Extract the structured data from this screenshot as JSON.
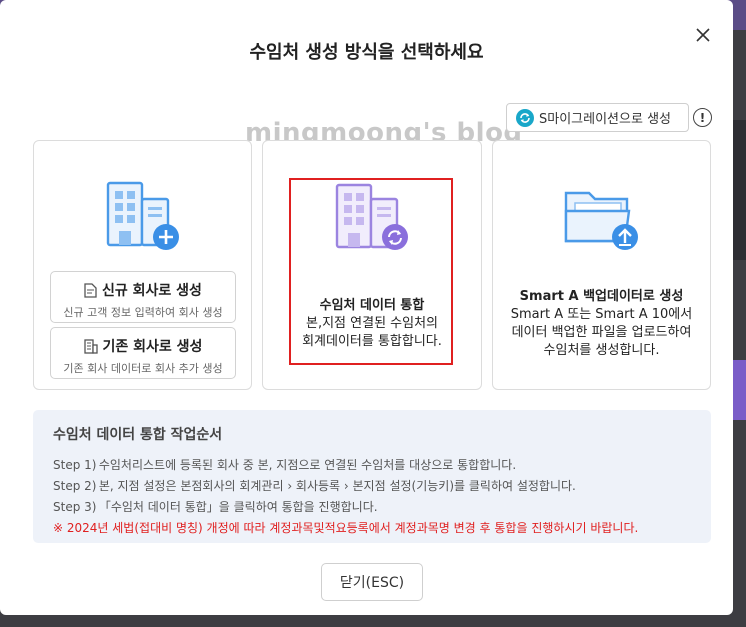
{
  "modal": {
    "title": "수임처 생성 방식을 선택하세요",
    "watermark": "mingmoong's blog"
  },
  "migrate_button": {
    "label": "S마이그레이션으로 생성"
  },
  "info_button": {
    "label": "!"
  },
  "card_new": {
    "new_company": {
      "title": "신규 회사로 생성",
      "subtitle": "신규 고객 정보 입력하여 회사 생성"
    },
    "existing_company": {
      "title": "기존 회사로 생성",
      "subtitle": "기존 회사 데이터로 회사 추가 생성"
    }
  },
  "card_merge": {
    "title": "수임처 데이터 통합",
    "line1": "본,지점 연결된 수임처의",
    "line2": "회계데이터를 통합합니다."
  },
  "card_backup": {
    "title": "Smart A 백업데이터로 생성",
    "line1": "Smart A 또는 Smart A 10에서",
    "line2": "데이터 백업한 파일을 업로드하여",
    "line3": "수임처를 생성합니다."
  },
  "steps": {
    "title": "수임처 데이터 통합 작업순서",
    "items": [
      {
        "num": "Step 1)",
        "text": "수임처리스트에 등록된 회사 중 본, 지점으로 연결된 수임처를 대상으로 통합합니다."
      },
      {
        "num": "Step 2)",
        "text": "본, 지점 설정은 본점회사의 회계관리 › 회사등록 › 본지점 설정(기능키)를 클릭하여 설정합니다."
      },
      {
        "num": "Step 3)",
        "text": "「수임처 데이터 통합」을 클릭하여 통합을 진행합니다."
      }
    ],
    "warning": "※ 2024년 세법(접대비 명칭) 개정에 따라 계정과목및적요등록에서 계정과목명 변경 후 통합을 진행하시기 바랍니다."
  },
  "footer": {
    "close_label": "닫기(ESC)"
  },
  "colors": {
    "highlight": "#e02020",
    "warning": "#e02020",
    "building_blue": "#4a9ae8",
    "building_purple": "#9b84e0",
    "migrate_icon": "#19a7c9"
  },
  "icons": [
    "close-icon",
    "sync-icon",
    "info-icon",
    "building-add-icon",
    "building-sync-icon",
    "folder-upload-icon",
    "document-icon",
    "building-small-icon"
  ]
}
